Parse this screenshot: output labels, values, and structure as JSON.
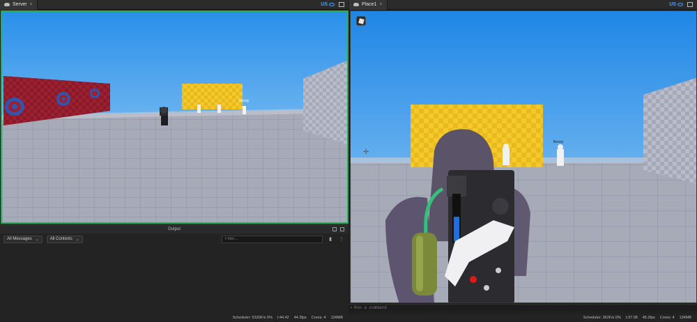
{
  "left_tab": {
    "label": "Server",
    "close": "×",
    "region": "US"
  },
  "right_tab": {
    "label": "Place1",
    "close": "×",
    "region": "US"
  },
  "server_view": {
    "player_label": "Bonny"
  },
  "client_view": {
    "player_label": "Bonny"
  },
  "output": {
    "title": "Output",
    "messages_filter": "All Messages",
    "contexts_filter": "All Contexts",
    "filter_placeholder": "Filter...",
    "clear_icon": "trash-icon",
    "more_icon": "more-vertical-icon"
  },
  "command_bar": {
    "placeholder": "Run a command"
  },
  "status_left": {
    "scheduler": "Scheduler: 5330F/s 0%",
    "time": "t:44.42",
    "fps": "44.3fps",
    "cores": "Cores: 4",
    "memory": "134MB"
  },
  "status_right": {
    "scheduler": "Scheduler: 362F/s 0%",
    "time": "t:37.08",
    "fps": "45.2fps",
    "cores": "Cores: 4",
    "memory": "134MB"
  },
  "colors": {
    "server_border": "#1fb157",
    "sky_top": "#2a8fea",
    "sky_bottom": "#a8d7f5",
    "baseplate": "#a7aab7",
    "yellow_wall": "#f5c92a",
    "red_wall": "#9b2030"
  }
}
